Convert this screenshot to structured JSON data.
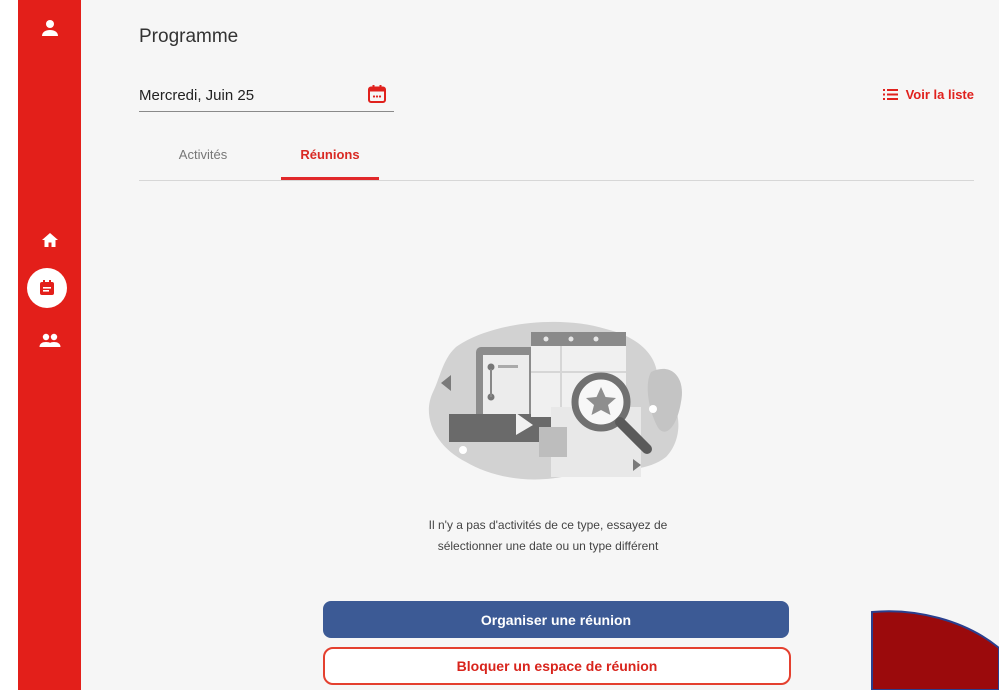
{
  "sidebar": {
    "items": [
      {
        "name": "profile",
        "icon": "user-icon"
      },
      {
        "name": "home",
        "icon": "home-icon"
      },
      {
        "name": "programme",
        "icon": "calendar-list-icon",
        "active": true
      },
      {
        "name": "network",
        "icon": "people-icon"
      }
    ],
    "color": "#e31f1a"
  },
  "header": {
    "title": "Programme",
    "date_value": "Mercredi, Juin 25",
    "calendar_icon": "calendar-icon",
    "list_link_label": "Voir la liste",
    "list_icon": "list-icon"
  },
  "tabs": [
    {
      "label": "Activités",
      "active": false
    },
    {
      "label": "Réunions",
      "active": true
    }
  ],
  "empty_state": {
    "illustration": "empty-search-illustration",
    "message_line1": "Il n'y a pas d'activités de ce type, essayez de",
    "message_line2": "sélectionner une date ou un type différent"
  },
  "actions": {
    "primary_label": "Organiser une réunion",
    "secondary_label": "Bloquer un espace de réunion"
  },
  "colors": {
    "accent_red": "#e31f1a",
    "primary_blue": "#3c5a95",
    "deco_fill": "#9b0a0c",
    "deco_stroke": "#2a3f8e"
  }
}
